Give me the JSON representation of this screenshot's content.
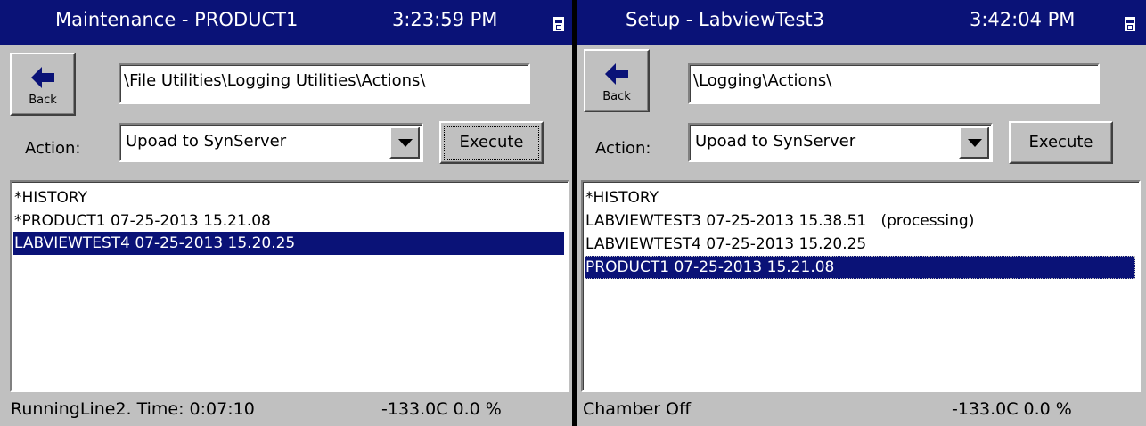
{
  "left": {
    "title": "Maintenance - PRODUCT1",
    "time": "3:23:59 PM",
    "back_label": "Back",
    "path": "\\File Utilities\\Logging Utilities\\Actions\\",
    "action_label": "Action:",
    "action_value": "Upoad to SynServer",
    "execute_label": "Execute",
    "items": [
      {
        "text": "*HISTORY",
        "selected": false
      },
      {
        "text": "*PRODUCT1 07-25-2013 15.21.08",
        "selected": false
      },
      {
        "text": "LABVIEWTEST4 07-25-2013 15.20.25",
        "selected": true
      }
    ],
    "status_left": "RunningLine2.  Time: 0:07:10",
    "status_right": "-133.0C  0.0 %"
  },
  "right": {
    "title": "Setup - LabviewTest3",
    "time": "3:42:04 PM",
    "back_label": "Back",
    "path": "\\Logging\\Actions\\",
    "action_label": "Action:",
    "action_value": "Upoad to SynServer",
    "execute_label": "Execute",
    "items": [
      {
        "text": "*HISTORY",
        "selected": false
      },
      {
        "text": "LABVIEWTEST3 07-25-2013 15.38.51   (processing)",
        "selected": false
      },
      {
        "text": "LABVIEWTEST4 07-25-2013 15.20.25",
        "selected": false
      },
      {
        "text": "PRODUCT1 07-25-2013 15.21.08",
        "selected": true
      }
    ],
    "status_left": "Chamber Off",
    "status_right": "-133.0C  0.0 %"
  },
  "colors": {
    "titlebar": "#0a1277",
    "selection": "#0a1277",
    "window": "#c0c0c0"
  },
  "icons": [
    "back-arrow-icon",
    "window-menu-icon",
    "dropdown-arrow-icon"
  ]
}
